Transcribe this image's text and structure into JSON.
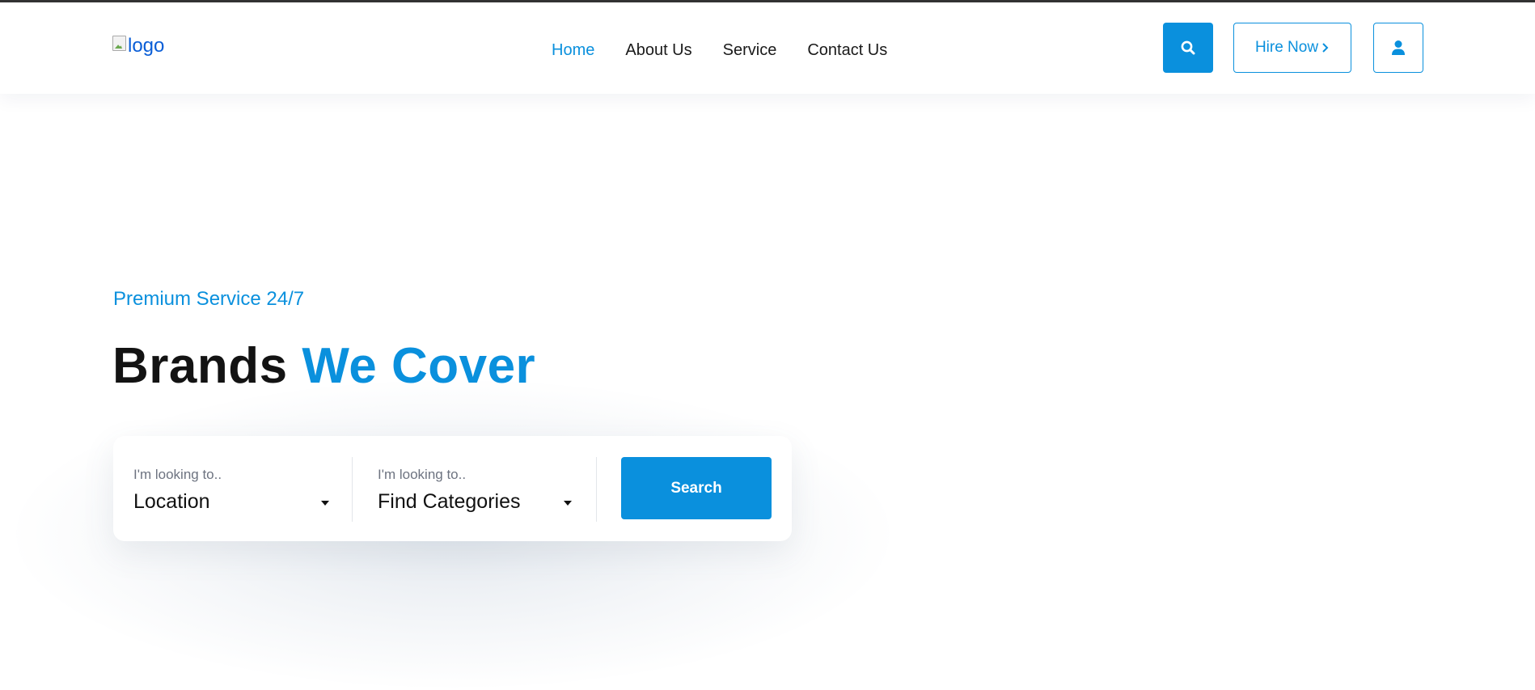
{
  "header": {
    "logo_alt": "logo",
    "nav": [
      {
        "label": "Home",
        "active": true
      },
      {
        "label": "About Us",
        "active": false
      },
      {
        "label": "Service",
        "active": false
      },
      {
        "label": "Contact Us",
        "active": false
      }
    ],
    "search_icon": "search-icon",
    "hire_label": "Hire Now",
    "hire_icon": "chevron-right-icon",
    "user_icon": "user-icon"
  },
  "hero": {
    "tagline": "Premium Service 24/7",
    "title_main": "Brands",
    "title_accent": "We Cover"
  },
  "search_form": {
    "location": {
      "label": "I'm looking to..",
      "value": "Location"
    },
    "category": {
      "label": "I'm looking to..",
      "value": "Find Categories"
    },
    "submit_label": "Search"
  },
  "colors": {
    "accent": "#0a90dd",
    "text_dark": "#131313",
    "muted": "#6d7380"
  }
}
